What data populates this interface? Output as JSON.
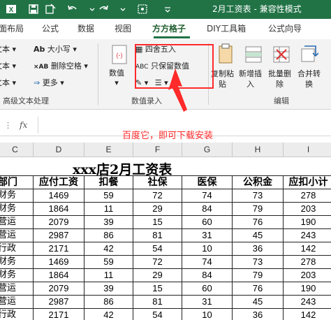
{
  "window": {
    "title": "2月工资表 - 兼容性模式",
    "title_bar_color": "#217346"
  },
  "quick_access": [
    "excel-logo-icon",
    "save-icon",
    "undo-icon",
    "redo-icon",
    "print-preview-icon",
    "customize-icon"
  ],
  "tabs": [
    {
      "label": "页面布局"
    },
    {
      "label": "公式"
    },
    {
      "label": "数据"
    },
    {
      "label": "视图"
    },
    {
      "label": "方方格子"
    },
    {
      "label": "DIY工具箱"
    },
    {
      "label": "公式向导"
    }
  ],
  "ribbon": {
    "text_group": {
      "items": [
        "文本",
        "文本",
        "文本"
      ],
      "font_size_label": "大小写",
      "delete_space_label": "删除空格",
      "more_label": "更多",
      "group_label": "高级文本处理"
    },
    "number_group": {
      "value_label": "数值",
      "round_label": "四舍五入",
      "keep_value_label": "只保留数值",
      "group_label": "数值录入"
    },
    "edit_group": {
      "copy_paste_label": "复制粘\n贴",
      "new_insert_label": "新增插\n入",
      "batch_delete_label": "批量删\n除",
      "merge_convert_label": "合并转\n换",
      "group_label": "编辑"
    }
  },
  "annotation": {
    "text": "百度它，即可下载安装",
    "color": "#ff2a2a"
  },
  "formula_bar": {
    "fx_label": "fx"
  },
  "columns": [
    "C",
    "D",
    "E",
    "F",
    "G",
    "H",
    "I"
  ],
  "sheet": {
    "title": "xxx店2月工资表",
    "headers": [
      "部门",
      "应付工资",
      "扣餐",
      "社保",
      "医保",
      "公积金",
      "应扣小计"
    ],
    "rows": [
      [
        "财务",
        "1469",
        "59",
        "72",
        "74",
        "73",
        "278"
      ],
      [
        "财务",
        "1864",
        "11",
        "29",
        "84",
        "79",
        "203"
      ],
      [
        "营运",
        "2079",
        "39",
        "15",
        "60",
        "76",
        "190"
      ],
      [
        "营运",
        "2987",
        "86",
        "81",
        "31",
        "45",
        "243"
      ],
      [
        "行政",
        "2171",
        "42",
        "54",
        "10",
        "36",
        "142"
      ],
      [
        "财务",
        "1469",
        "59",
        "72",
        "74",
        "73",
        "278"
      ],
      [
        "财务",
        "1864",
        "11",
        "29",
        "84",
        "79",
        "203"
      ],
      [
        "营运",
        "2079",
        "39",
        "15",
        "60",
        "76",
        "190"
      ],
      [
        "营运",
        "2987",
        "86",
        "81",
        "31",
        "45",
        "243"
      ],
      [
        "行政",
        "2171",
        "42",
        "54",
        "10",
        "36",
        "142"
      ]
    ]
  }
}
